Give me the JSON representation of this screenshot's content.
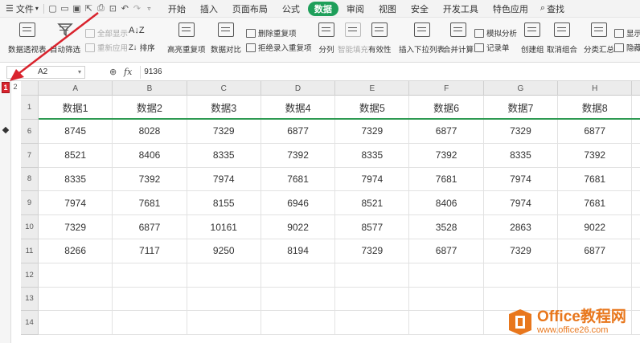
{
  "menubar": {
    "file_label": "文件",
    "tabs": [
      {
        "label": "开始"
      },
      {
        "label": "插入"
      },
      {
        "label": "页面布局"
      },
      {
        "label": "公式"
      },
      {
        "label": "数据",
        "active": true
      },
      {
        "label": "审阅"
      },
      {
        "label": "视图"
      },
      {
        "label": "安全"
      },
      {
        "label": "开发工具"
      },
      {
        "label": "特色应用"
      }
    ],
    "search_label": "查找"
  },
  "ribbon": {
    "pivot": "数据透视表",
    "autofilter": "自动筛选",
    "show_all": "全部显示",
    "reapply": "重新应用",
    "sort": "排序",
    "highlight_dup": "高亮重复项",
    "compare": "数据对比",
    "delete_dup": "删除重复项",
    "reject_dup": "拒绝录入重复项",
    "split": "分列",
    "smart_fill": "智能填充",
    "validity": "有效性",
    "insert_dropdown": "插入下拉列表",
    "consolidate": "合并计算",
    "what_if": "模拟分析",
    "record": "记录单",
    "create_group": "创建组",
    "ungroup": "取消组合",
    "subtotal": "分类汇总",
    "show_detail": "显示明",
    "hide_detail": "隐藏明"
  },
  "formula_bar": {
    "name_box": "A2",
    "fx": "fx",
    "value": "9136"
  },
  "grid": {
    "outline_levels": [
      "1",
      "2"
    ],
    "columns": [
      "A",
      "B",
      "C",
      "D",
      "E",
      "F",
      "G",
      "H"
    ],
    "row_numbers": [
      "1",
      "6",
      "7",
      "8",
      "9",
      "10",
      "11",
      "12",
      "13",
      "14"
    ],
    "header": [
      "数据1",
      "数据2",
      "数据3",
      "数据4",
      "数据5",
      "数据6",
      "数据7",
      "数据8"
    ],
    "rows": [
      [
        "8745",
        "8028",
        "7329",
        "6877",
        "7329",
        "6877",
        "7329",
        "6877"
      ],
      [
        "8521",
        "8406",
        "8335",
        "7392",
        "8335",
        "7392",
        "8335",
        "7392"
      ],
      [
        "8335",
        "7392",
        "7974",
        "7681",
        "7974",
        "7681",
        "7974",
        "7681"
      ],
      [
        "7974",
        "7681",
        "8155",
        "6946",
        "8521",
        "8406",
        "7974",
        "7681"
      ],
      [
        "7329",
        "6877",
        "10161",
        "9022",
        "8577",
        "3528",
        "2863",
        "9022"
      ],
      [
        "8266",
        "7117",
        "9250",
        "8194",
        "7329",
        "6877",
        "7329",
        "6877"
      ],
      [
        "",
        "",
        "",
        "",
        "",
        "",
        "",
        ""
      ],
      [
        "",
        "",
        "",
        "",
        "",
        "",
        "",
        ""
      ],
      [
        "",
        "",
        "",
        "",
        "",
        "",
        "",
        ""
      ]
    ]
  },
  "watermark": {
    "title": "Office教程网",
    "url": "www.office26.com"
  },
  "colors": {
    "accent": "#1e9f5a",
    "annotation": "#d9232d",
    "watermark": "#e8771d"
  }
}
